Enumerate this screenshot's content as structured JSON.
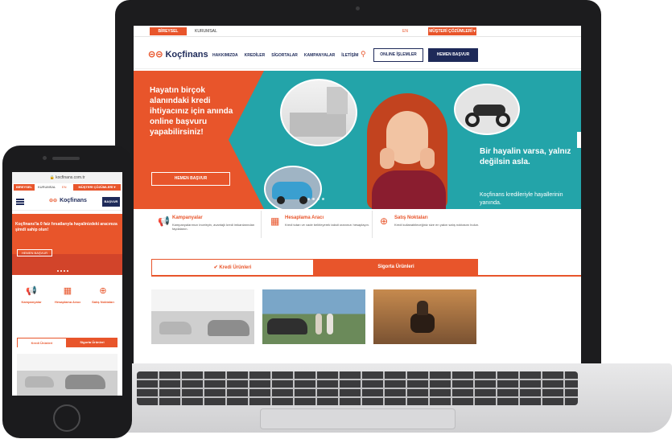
{
  "laptop": {
    "topbar": {
      "left_pill": "BİREYSEL",
      "kurumsal": "KURUMSAL",
      "lang": "EN",
      "right_pill": "MÜŞTERİ ÇÖZÜMLERİ ▾"
    },
    "nav": {
      "logo": "Koçfinans",
      "menu": [
        "HAKKIMIZDA",
        "KREDİLER",
        "SİGORTALAR",
        "KAMPANYALAR",
        "İLETİŞİM"
      ],
      "online_label": "ONLINE İŞLEMLER",
      "apply_label": "HEMEN BAŞVUR"
    },
    "hero": {
      "headline": "Hayatın birçok alanındaki kredi ihtiyacınız için anında online başvuru yapabilirsiniz!",
      "button": "HEMEN BAŞVUR",
      "tagline_bold": "Bir hayalin varsa, yalnız değilsin asla.",
      "tagline": "Koçfinans kredileriyle hayallerinin yanında."
    },
    "features": [
      {
        "icon": "megaphone-icon",
        "title": "Kampanyalar",
        "desc": "Kampanyalarımızı inceleyin, avantajlı kredi imkanlarından faydalanın."
      },
      {
        "icon": "calculator-icon",
        "title": "Hesaplama Aracı",
        "desc": "Kredi tutarı ve vade belirleyerek taksit oranınızı hesaplayın."
      },
      {
        "icon": "location-icon",
        "title": "Satış Noktaları",
        "desc": "Kredi kullanabileceğiniz size en yakın satış noktasını bulun."
      }
    ],
    "tabs": {
      "credit": "Kredi Ürünleri",
      "insurance": "Sigorta Ürünleri"
    }
  },
  "phone": {
    "url": "kocfinans.com.tr",
    "strip": [
      "BİREYSEL",
      "KURUMSAL",
      "EN",
      "MÜŞTERİ ÇÖZÜMLERİ ▾"
    ],
    "logo": "Koçfinans",
    "apply": "BAŞVUR",
    "hero_text": "Koçfinans'la 0 faiz fırsatlarıyla hayalinizdeki aracınıza şimdi sahip olun!",
    "hero_button": "HEMEN BAŞVUR",
    "features": [
      "Kampanyalar",
      "Hesaplama Aracı",
      "Satış Noktaları"
    ],
    "tabs": {
      "credit": "Kredi Ürünleri",
      "insurance": "Sigorta Ürünleri"
    }
  },
  "colors": {
    "brand_orange": "#e8552b",
    "brand_navy": "#1e2a59",
    "hero_teal": "#23a4a9"
  }
}
